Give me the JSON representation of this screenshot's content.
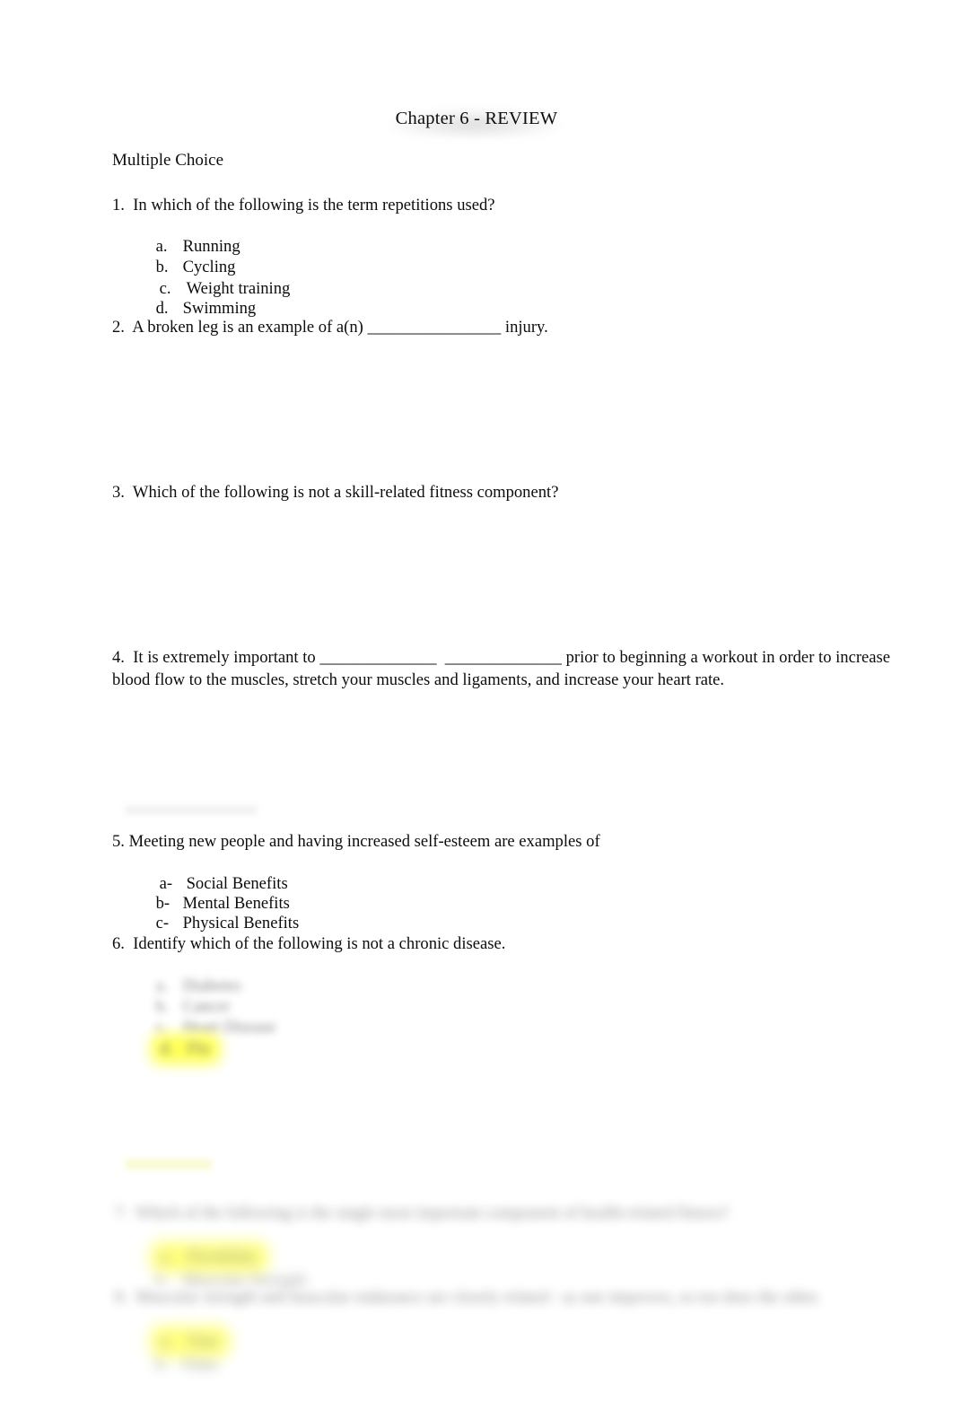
{
  "document": {
    "title": "Chapter 6 - REVIEW",
    "section_label": "Multiple Choice"
  },
  "questions": [
    {
      "number": "1.",
      "stem": "1.  In which of the following is the term repetitions used?",
      "options": [
        {
          "mark": "a.",
          "text": "Running",
          "highlighted": false
        },
        {
          "mark": "b.",
          "text": "Cycling",
          "highlighted": false
        },
        {
          "mark": "c.",
          "text": "Weight training",
          "highlighted": true
        },
        {
          "mark": "d.",
          "text": "Swimming",
          "highlighted": false
        }
      ]
    },
    {
      "number": "2.",
      "stem": "2.  A broken leg is an example of a(n) ________________ injury.",
      "options": []
    },
    {
      "number": "3.",
      "stem": "3.  Which of the following is not a skill-related fitness component?",
      "options": []
    },
    {
      "number": "4.",
      "stem_line1": "4.  It is extremely important to ______________  ______________ prior to beginning a workout in order to increase",
      "stem_line2": "blood flow to the muscles, stretch your muscles and ligaments, and increase your heart rate.",
      "options": []
    },
    {
      "number": "5.",
      "stem": "5. Meeting new people and having increased self-esteem are examples of",
      "options": [
        {
          "mark": "a-",
          "text": "Social Benefits",
          "highlighted": true
        },
        {
          "mark": "b-",
          "text": "Mental Benefits",
          "highlighted": false
        },
        {
          "mark": "c-",
          "text": "Physical Benefits",
          "highlighted": false
        }
      ]
    },
    {
      "number": "6.",
      "stem": "6.  Identify which of the following is not a chronic disease.",
      "options_redacted": [
        {
          "mark": "a.",
          "text": "Diabetes",
          "highlighted": false
        },
        {
          "mark": "b.",
          "text": "Cancer",
          "highlighted": false
        },
        {
          "mark": "c.",
          "text": "Heart Disease",
          "highlighted": false
        },
        {
          "mark": "d.",
          "text": "Flu",
          "highlighted": true
        }
      ]
    },
    {
      "number": "7.",
      "stem_redacted": "7.  Which of the following is the single most important component of health-related fitness?",
      "options_redacted": [
        {
          "mark": "a.",
          "text": "Flexibility",
          "highlighted": true
        },
        {
          "mark": "b.",
          "text": "Muscular Strength",
          "highlighted": false
        }
      ]
    },
    {
      "number": "8.",
      "stem_redacted": "8.  Muscular strength and muscular endurance are closely related - as one improves, so too does the other.",
      "options_redacted": [
        {
          "mark": "a.",
          "text": "True",
          "highlighted": true
        },
        {
          "mark": "b.",
          "text": "False",
          "highlighted": false
        }
      ]
    }
  ],
  "colors": {
    "highlight": "#FFFF00",
    "text": "#0D0D0D",
    "page_background": "#FFFFFF"
  }
}
